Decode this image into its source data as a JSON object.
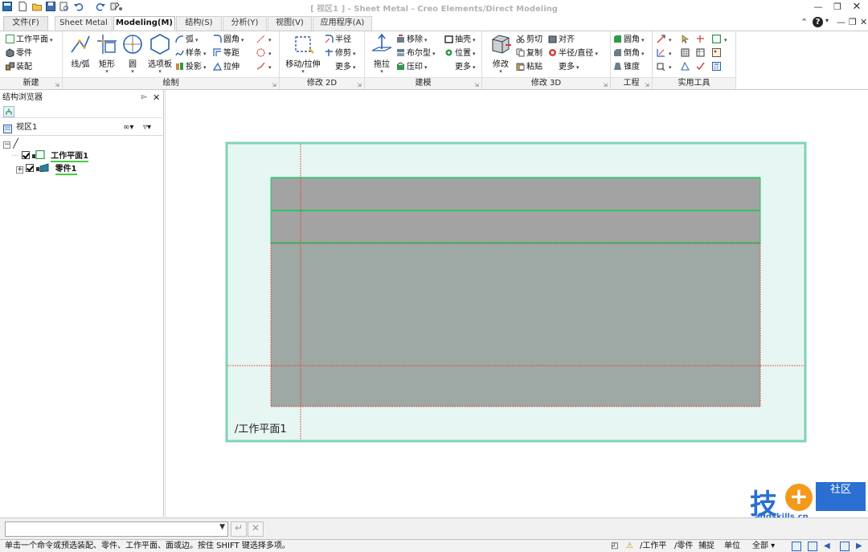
{
  "window": {
    "title": "[ 视区1 ] - Sheet Metal - Creo Elements/Direct Modeling"
  },
  "tabs": [
    {
      "label": "文件(F)"
    },
    {
      "label": "Sheet Metal"
    },
    {
      "label": "Modeling(M)"
    },
    {
      "label": "结构(S)"
    },
    {
      "label": "分析(Y)"
    },
    {
      "label": "视图(V)"
    },
    {
      "label": "应用程序(A)"
    }
  ],
  "ribbon": {
    "new": {
      "label": "新建",
      "items": [
        "工作平面",
        "零件",
        "装配"
      ]
    },
    "draw": {
      "label": "绘制",
      "big": [
        "线/弧",
        "矩形",
        "圆",
        "选项板"
      ],
      "small": [
        "弧",
        "样条",
        "投影",
        "圆角",
        "等距",
        "拉伸"
      ]
    },
    "modify2d": {
      "label": "修改 2D",
      "big": [
        "移动/拉伸"
      ],
      "small": [
        "半径",
        "修剪",
        "更多"
      ]
    },
    "model": {
      "label": "建模",
      "big": [
        "拖拉"
      ],
      "small": [
        "移除",
        "布尔型",
        "压印",
        "抽壳",
        "位置",
        "更多"
      ]
    },
    "modify3d": {
      "label": "修改 3D",
      "big": [
        "修改"
      ],
      "small": [
        "剪切",
        "复制",
        "粘贴",
        "对齐",
        "半径/直径",
        "更多"
      ]
    },
    "engineering": {
      "label": "工程",
      "items": [
        "圆角",
        "倒角",
        "锥度"
      ]
    },
    "utilities": {
      "label": "实用工具"
    }
  },
  "browser": {
    "title": "结构浏览器",
    "view_name": "视区1",
    "tree": [
      {
        "label": "工作平面1",
        "checked": true
      },
      {
        "label": "零件1",
        "checked": true
      }
    ]
  },
  "viewport": {
    "workplane_label": "工作平面1"
  },
  "status": {
    "message": "单击一个命令或预选装配、零件、工作平面、面或边。按住 SHIFT 键选择多项。",
    "wp": "/工作平",
    "part": "/零件",
    "snap": "捕捉",
    "units": "单位",
    "filter": "全部"
  },
  "watermark": {
    "brand": "技",
    "sub": "社区",
    "url": "addskills.cn"
  },
  "colors": {
    "workplane_fill": "#e6f6f2",
    "workplane_border": "#7fd4b6",
    "part_fill": "#9ea8a4",
    "part_top": "#a3a3a3",
    "edge_green": "#2ec56c",
    "axis_red": "#e33333"
  }
}
